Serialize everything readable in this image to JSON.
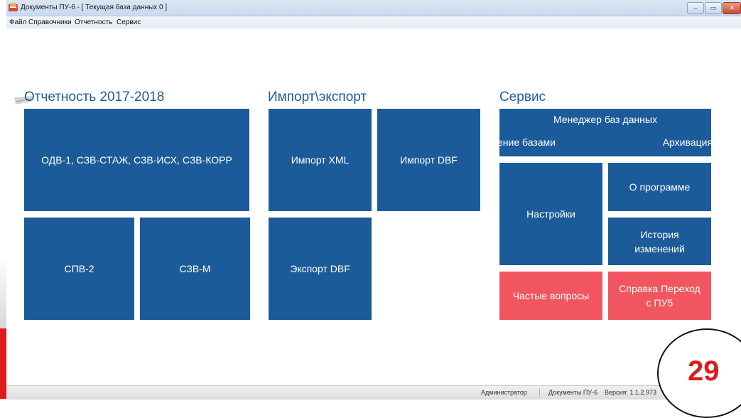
{
  "window": {
    "title": "Документы ПУ-6  - [ Текущая база данных 0 ]",
    "buttons": {
      "minimize": "–",
      "maximize": "▭",
      "close": "✕"
    }
  },
  "menu": [
    "Файл",
    "Справочники",
    "Отчетность",
    "Сервис"
  ],
  "sections": {
    "reporting": {
      "title": "Отчетность 2017-2018",
      "tiles": {
        "main": "ОДВ-1, СЗВ-СТАЖ, СЗВ-ИСХ, СЗВ-КОРР",
        "spv2": "СПВ-2",
        "szvm": "СЗВ-М"
      }
    },
    "import_export": {
      "title": "Импорт\\экспорт",
      "tiles": {
        "import_xml": "Импорт XML",
        "import_dbf": "Импорт DBF",
        "export_dbf": "Экспорт DBF"
      }
    },
    "service": {
      "title": "Сервис",
      "tiles": {
        "db_manager": "Менеджер баз данных",
        "db_manage_partial": "ение базами",
        "archive": "Архивация",
        "settings": "Настройки",
        "about": "О программе",
        "history": "История изменений",
        "faq": "Частые вопросы",
        "help": "Справка Переход с ПУ5"
      }
    }
  },
  "status": {
    "user": "Администратор",
    "app": "Документы ПУ-6",
    "version": "Версия: 1.1.2.973"
  },
  "slide_number": "29",
  "colors": {
    "tile_blue": "#1c5b99",
    "tile_red": "#f15660",
    "section_title": "#1e5a96",
    "slide_number": "#e01b1b"
  }
}
